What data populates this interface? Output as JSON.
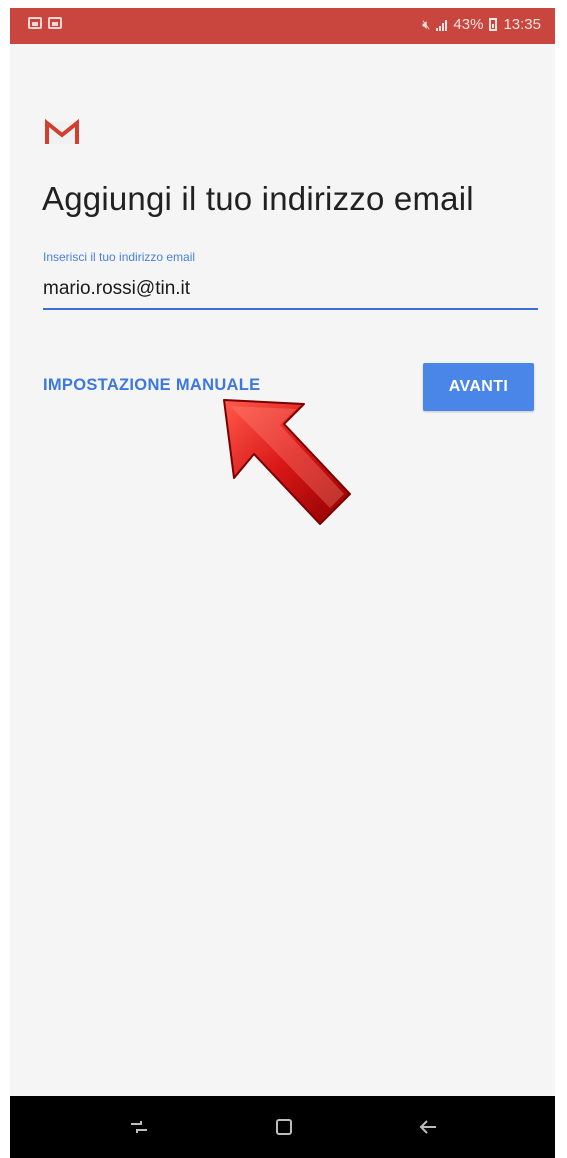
{
  "status_bar": {
    "battery": "43%",
    "time": "13:35",
    "background_color": "#c8463e",
    "left_icons": [
      "image-notification-icon",
      "message-notification-icon"
    ],
    "right_icons": [
      "mute-icon",
      "signal-icon",
      "battery-icon"
    ]
  },
  "header": {
    "logo": "gmail-icon",
    "title": "Aggiungi il tuo indirizzo email"
  },
  "form": {
    "email_label": "Inserisci il tuo indirizzo email",
    "email_value": "mario.rossi@tin.it",
    "accent_color": "#3d6fd9"
  },
  "actions": {
    "manual_setup_label": "IMPOSTAZIONE MANUALE",
    "next_label": "AVANTI",
    "button_color": "#4a86e8"
  },
  "nav_bar": {
    "icons": [
      "recents-icon",
      "home-icon",
      "back-icon"
    ]
  }
}
